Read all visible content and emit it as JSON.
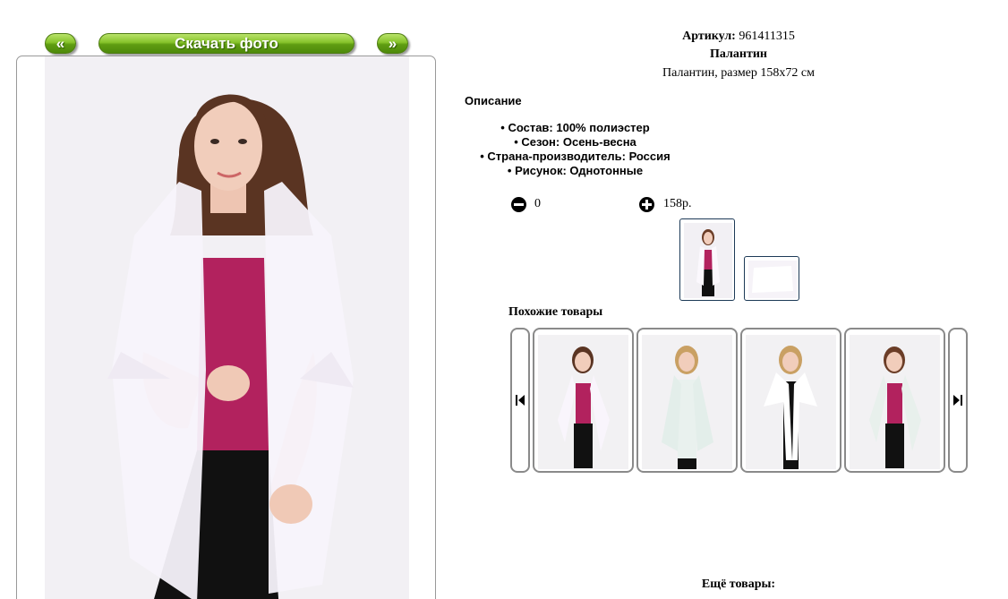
{
  "nav": {
    "prev_label": "«",
    "download_label": "Скачать фото",
    "next_label": "»"
  },
  "product": {
    "article_label": "Артикул:",
    "article_value": "961411315",
    "title": "Палантин",
    "subtitle": "Палантин, размер 158x72 см"
  },
  "description": {
    "heading": "Описание",
    "items": [
      "Состав: 100% полиэстер",
      "Сезон: Осень-весна",
      "Страна-производитель: Россия",
      "Рисунок: Однотонные"
    ]
  },
  "order": {
    "quantity": "0",
    "price": "158р.",
    "minus_icon": "minus-circle-icon",
    "plus_icon": "plus-circle-icon"
  },
  "similar": {
    "heading": "Похожие товары",
    "prev_icon": "skip-back-icon",
    "next_icon": "skip-forward-icon"
  },
  "more": {
    "heading": "Ещё товары:"
  },
  "colors": {
    "button_green": "#6fae1c",
    "scarf_white": "#f7f3fb",
    "top_magenta": "#b2225e",
    "link_green": "#2a7a2a"
  }
}
